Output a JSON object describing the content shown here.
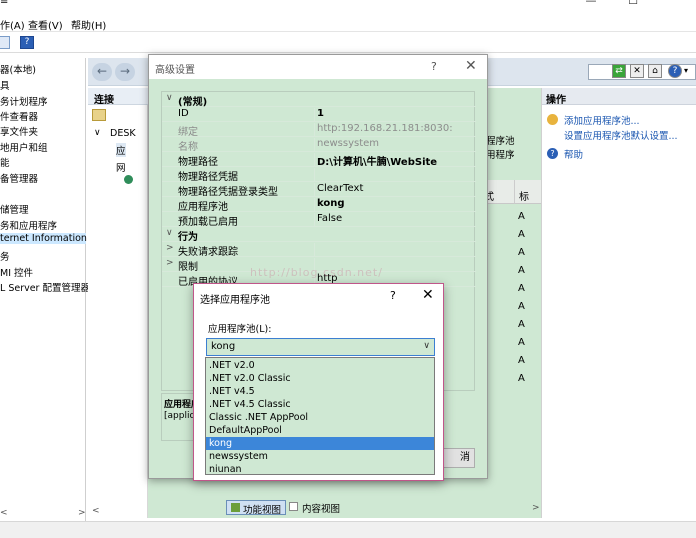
{
  "app": {
    "window_controls": [
      "—",
      "☐",
      ""
    ],
    "menu": [
      "作(A)",
      "查看(V)",
      "帮助(H)"
    ]
  },
  "left_tree": [
    "器(本地)",
    "具",
    "务计划程序",
    "件查看器",
    "享文件夹",
    "地用户和组",
    "能",
    "备管理器",
    "",
    "储管理",
    "务和应用程序",
    "ternet Information S",
    "务",
    "MI 控件",
    "L Server 配置管理器"
  ],
  "connections": {
    "header": "连接",
    "items": [
      "DESK",
      "应",
      "网"
    ]
  },
  "center": {
    "partial_text_1": "程序池",
    "partial_text_2": "用程序",
    "column_partial_a": "式",
    "column_partial_b": "标",
    "row_letters": [
      "A",
      "A",
      "A",
      "A",
      "A",
      "A",
      "A",
      "A",
      "A",
      "A"
    ]
  },
  "actions": {
    "header": "操作",
    "items": [
      {
        "label": "添加应用程序池...",
        "icon": "add-pool-icon"
      },
      {
        "label": "设置应用程序池默认设置...",
        "icon": ""
      },
      {
        "label": "帮助",
        "icon": "help-icon"
      }
    ]
  },
  "bottom_tabs": {
    "features_view": "功能视图",
    "content_view": "内容视图"
  },
  "advanced_settings": {
    "title": "高级设置",
    "help_glyph": "?",
    "close_glyph": "✕",
    "rows": [
      {
        "type": "category",
        "key": "(常规)",
        "expanded": true
      },
      {
        "type": "prop",
        "key": "ID",
        "value": "1",
        "bold_value": true
      },
      {
        "type": "prop",
        "key": "绑定",
        "value": "http:192.168.21.181:8030:",
        "gray": true
      },
      {
        "type": "prop",
        "key": "名称",
        "value": "newssystem",
        "gray": true
      },
      {
        "type": "prop",
        "key": "物理路径",
        "value": "D:\\计算机\\牛腩\\WebSite",
        "bold_value": true
      },
      {
        "type": "prop",
        "key": "物理路径凭据",
        "value": ""
      },
      {
        "type": "prop",
        "key": "物理路径凭据登录类型",
        "value": "ClearText"
      },
      {
        "type": "prop",
        "key": "应用程序池",
        "value": "kong",
        "bold_value": true
      },
      {
        "type": "prop",
        "key": "预加载已启用",
        "value": "False"
      },
      {
        "type": "category",
        "key": "行为",
        "expanded": true
      },
      {
        "type": "subcat",
        "key": "失败请求跟踪",
        "value": ""
      },
      {
        "type": "subcat",
        "key": "限制",
        "value": ""
      },
      {
        "type": "prop",
        "key": "已启用的协议",
        "value": "http"
      }
    ],
    "desc_title": "应用程序",
    "desc_text": "[applic",
    "button_partial": "消"
  },
  "watermark": "http://blog.csdn.net/",
  "select_pool": {
    "title": "选择应用程序池",
    "help_glyph": "?",
    "close_glyph": "✕",
    "label": "应用程序池(L):",
    "selected": "kong",
    "options": [
      ".NET v2.0",
      ".NET v2.0 Classic",
      ".NET v4.5",
      ".NET v4.5 Classic",
      "Classic .NET AppPool",
      "DefaultAppPool",
      "kong",
      "newssystem",
      "niunan"
    ],
    "highlighted_index": 6
  }
}
